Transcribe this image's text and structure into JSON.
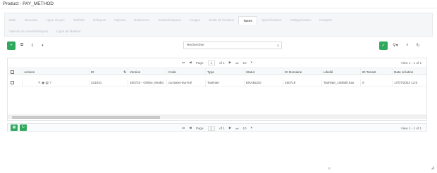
{
  "window": {
    "title": "Product - PAY_METHOD"
  },
  "tabs_row1": [
    "Main",
    "Nouveau",
    "Ligne de prix",
    "Tarifaire",
    "Critiques",
    "Options",
    "Ressource",
    "Caractéristiques",
    "Images",
    "Mode de livraison",
    "Taxes",
    "Spécifications",
    "Catégorisation",
    "Comptes"
  ],
  "tabs_row2": [
    "Valeurs de caractéristiques",
    "Ligne de libelleur"
  ],
  "active_tab": "Taxes",
  "toolbar": {
    "add_icon": "plus-icon",
    "copy_icon": "copy-icon",
    "export_icon": "download-icon",
    "filter_icon": "filter-icon",
    "check_icon": "check-icon",
    "filter_menu_icon": "filter-dropdown-icon",
    "zoom_icon": "search-zoom-icon",
    "refresh_icon": "refresh-icon"
  },
  "search": {
    "placeholder": "Rechercher"
  },
  "pager_top": {
    "page_label": "Page",
    "page": "1",
    "of_label": "of 1",
    "page_size": "10",
    "info": "View 1 - 1 of 1"
  },
  "table": {
    "columns": [
      "",
      "Actions",
      "ID",
      "Version",
      "Code",
      "Type",
      "Statut",
      "ID Domaine",
      "Libellé",
      "ID Tenant",
      "Date création"
    ],
    "rows": [
      {
        "id": "221041",
        "version": "160723 - Online_Media",
        "code": "ca-taxes-tau-full",
        "type": "TaxRate",
        "status": "ENABLED",
        "domain_id": "160719",
        "label": "TaxRate_160680.ttax",
        "tenant": "0",
        "created": "17/07/2023 12:0"
      }
    ]
  },
  "pager_bottom": {
    "page_label": "Page",
    "page": "1",
    "of_label": "of 1",
    "page_size": "10",
    "info": "View 1 - 1 of 1"
  }
}
